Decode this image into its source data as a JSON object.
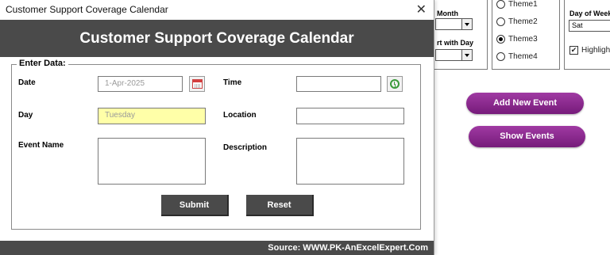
{
  "window": {
    "title": "Customer Support Coverage Calendar",
    "header": "Customer Support Coverage Calendar",
    "footer": "Source: WWW.PK-AnExcelExpert.Com"
  },
  "form": {
    "legend": "Enter Data:",
    "date_label": "Date",
    "date_value": "1-Apr-2025",
    "time_label": "Time",
    "time_value": "",
    "day_label": "Day",
    "day_value": "Tuesday",
    "location_label": "Location",
    "location_value": "",
    "event_name_label": "Event Name",
    "event_name_value": "",
    "description_label": "Description",
    "description_value": "",
    "submit_label": "Submit",
    "reset_label": "Reset"
  },
  "sheet": {
    "month_label": "Month",
    "start_day_label": "rt with Day",
    "themes": [
      {
        "label": "Theme1",
        "selected": false
      },
      {
        "label": "Theme2",
        "selected": false
      },
      {
        "label": "Theme3",
        "selected": true
      },
      {
        "label": "Theme4",
        "selected": false
      }
    ],
    "day_of_week_label": "Day of Week",
    "day_of_week_value": "Sat",
    "highlight_label": "Highligh",
    "highlight_checked": true,
    "add_event_label": "Add New Event",
    "show_events_label": "Show Events"
  },
  "colors": {
    "header_bg": "#4a4a4a",
    "pill_button": "#8a2a8e",
    "day_field_bg": "#ffffa8"
  }
}
